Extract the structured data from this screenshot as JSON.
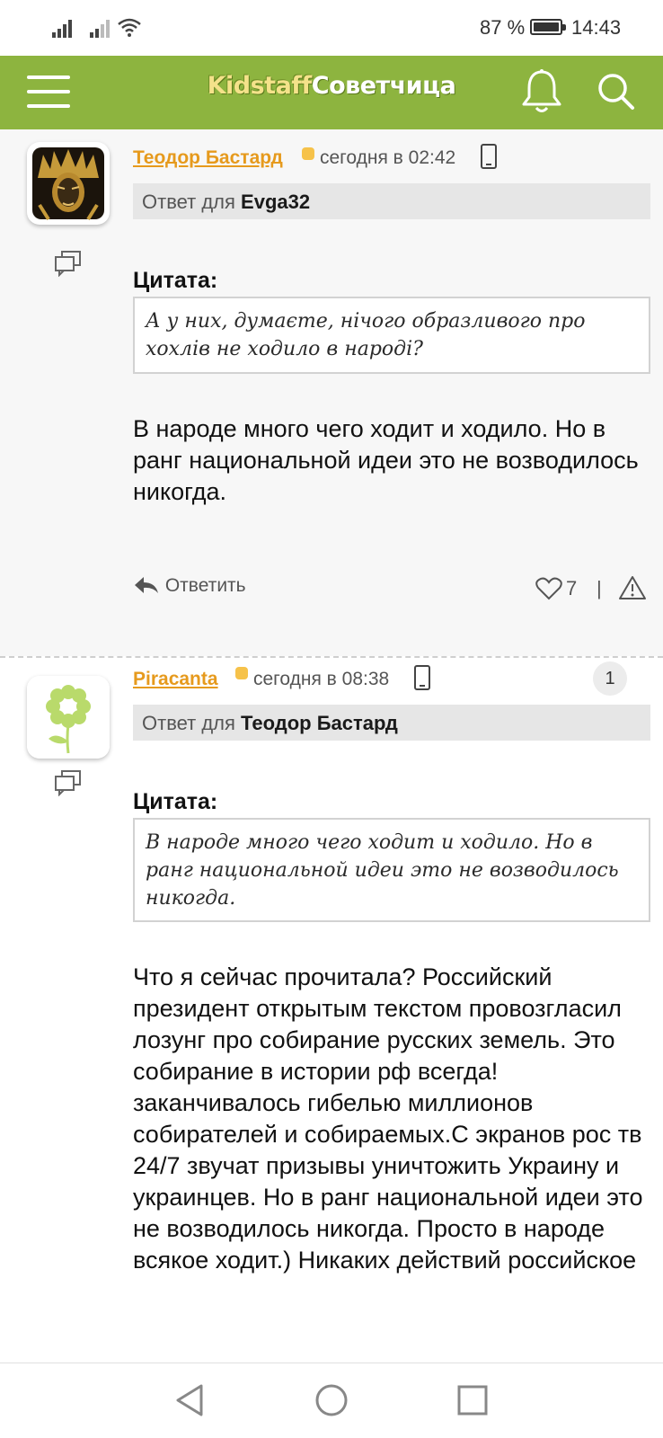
{
  "status_bar": {
    "battery": "87 %",
    "time": "14:43",
    "icons": [
      "signal-icon",
      "signal-icon",
      "wifi-icon",
      "battery-icon"
    ],
    "battery_level": 0.87
  },
  "app_bar": {
    "brand_part1": "Kidstaff",
    "brand_part2": "Советчица",
    "icons": [
      "menu-icon",
      "bell-icon",
      "search-icon"
    ],
    "color": "#8db43f"
  },
  "posts": [
    {
      "author": "Теодор Бастард",
      "time": "сегодня в 02:42",
      "reply_prefix": "Ответ для",
      "reply_to": "Evga32",
      "quote_label": "Цитата:",
      "quote": "А у них, думаєте, нічого образливого про хохлів не ходило в народі?",
      "text": "В народе много чего ходит и ходило. Но в ранг национальной идеи это не возводилось никогда.",
      "reply_label": "Ответить",
      "likes": "7",
      "separator": "|"
    },
    {
      "author": "Piracanta",
      "time": "сегодня в 08:38",
      "badge": "1",
      "reply_prefix": "Ответ для",
      "reply_to": "Теодор Бастард",
      "quote_label": "Цитата:",
      "quote": "В народе много чего ходит и ходило. Но в ранг национальной идеи это не возводилось никогда.",
      "text": "Что я сейчас прочитала? Российский президент открытым текстом провозгласил лозунг про собирание русских земель. Это собирание в истории рф всегда! заканчивалось гибелью миллионов собирателей и собираемых.С экранов рос тв 24/7 звучат призывы уничтожить Украину и украинцев. Но в ранг национальной идеи это не возводилось никогда. Просто в народе всякое ходит.) Никаких действий российское"
    }
  ],
  "nav_bar": {
    "icons": [
      "back-icon",
      "home-icon",
      "recents-icon"
    ]
  }
}
